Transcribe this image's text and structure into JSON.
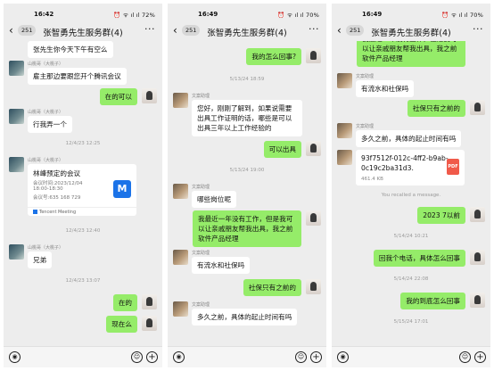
{
  "common": {
    "title": "张智勇先生服务群(4)",
    "badge": "251",
    "back_icon": "chevron-left-icon",
    "more_icon": "more-icon"
  },
  "panel1": {
    "time": "16:42",
    "status_icons": "⏰ ᯤ ıl ıl 72%",
    "msg1": "张先生你今天下午有空么",
    "sender1": "山桃哥（大桃子）",
    "msg2": "雇主那边要跟您开个腾讯会议",
    "msg3": "在的可以",
    "msg4": "行我弄一个",
    "stamp1": "12/4/23 12:25",
    "card_title": "林峰预定的会议",
    "card_line1": "会议时间:2023/12/04",
    "card_line2": "18:00-18:30",
    "card_line3": "会议号:635 168 729",
    "card_footer": "Tencent Meeting",
    "stamp2": "12/4/23 12:40",
    "msg5": "兄弟",
    "stamp3": "12/4/23 13:07",
    "msg6": "在的",
    "msg7": "现在么"
  },
  "panel2": {
    "time": "16:49",
    "status_icons": "⏰ ᯤ ıl ıl 70%",
    "msg1": "我的怎么回事?",
    "stamp1": "5/13/24 18:59",
    "sender": "文案助理",
    "msg2": "您好，刚刚了解到，如果说需要出具工作证明的话，哪些是可以出具三年以上工作经验的",
    "msg3": "可以出具",
    "stamp2": "5/13/24 19:00",
    "msg4": "哪些岗位呢",
    "msg5": "我最近一年没有工作，但是我可以让亲戚朋友帮我出具，我之前软件产品经理",
    "msg6": "有流水和社保吗",
    "msg7": "社保只有之前的",
    "msg8": "多久之前，具体的起止时间有吗"
  },
  "panel3": {
    "time": "16:49",
    "status_icons": "⏰ ᯤ ıl ıl 70%",
    "msg1": "我最近一年没有工作，但是我可以让亲戚朋友帮我出具，我之前软件产品经理",
    "sender": "文案助理",
    "msg2": "有流水和社保吗",
    "msg3": "社保只有之前的",
    "msg4": "多久之前，具体的起止时间有吗",
    "file_name": "93f7512f-012c-4ff2-b9ab-0c19c2ba31d3.",
    "file_size": "461.4 KB",
    "file_type": "PDF",
    "recalled": "You recalled a message.",
    "msg5": "2023 7以前",
    "stamp1": "5/14/24 10:21",
    "msg6": "回我个电话，具体怎么回事",
    "stamp2": "5/14/24 22:08",
    "msg7": "我的到底怎么回事",
    "stamp3": "5/15/24 17:01"
  }
}
